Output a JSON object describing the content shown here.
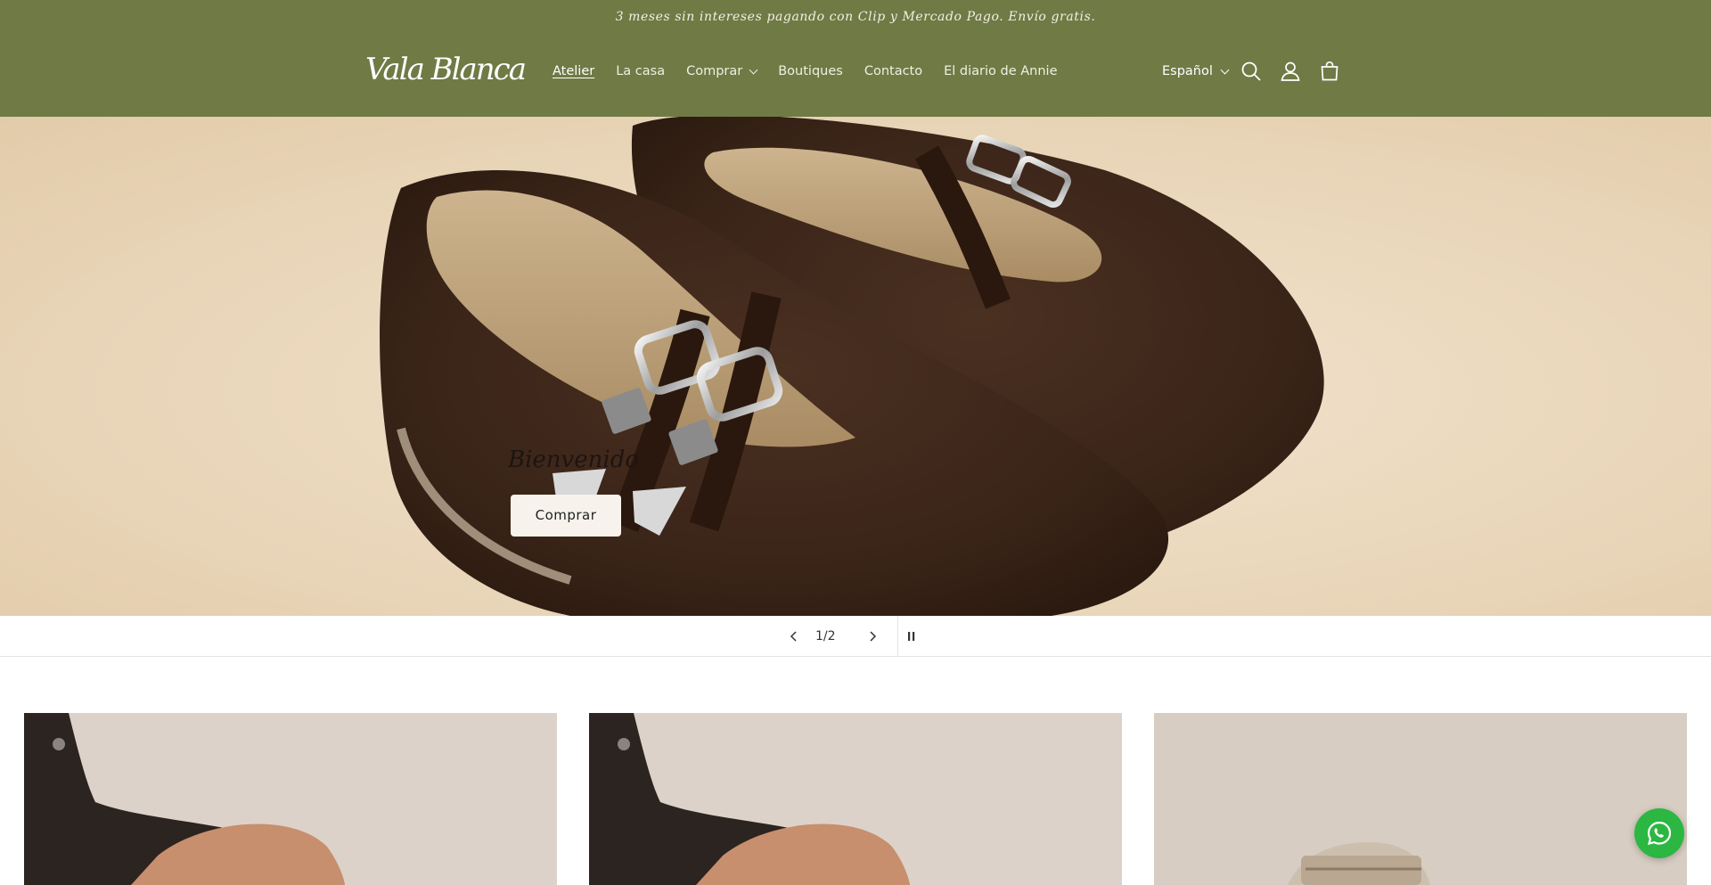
{
  "announcement": "3 meses sin intereses pagando con Clip y Mercado Pago. Envío gratis.",
  "header": {
    "logo": "Vala Blanca",
    "nav": [
      {
        "label": "Atelier",
        "active": true
      },
      {
        "label": "La casa"
      },
      {
        "label": "Comprar",
        "dropdown": true
      },
      {
        "label": "Boutiques"
      },
      {
        "label": "Contacto"
      },
      {
        "label": "El diario de Annie"
      }
    ],
    "language": "Español",
    "icons": [
      "search-icon",
      "account-icon",
      "cart-icon"
    ]
  },
  "hero": {
    "title": "Bienvenido",
    "button": "Comprar"
  },
  "slider": {
    "current": "1",
    "total": "2",
    "separator": "/",
    "icons": [
      "chevron-left-icon",
      "chevron-right-icon",
      "pause-icon"
    ]
  },
  "colors": {
    "header_bg": "#6f7a45",
    "announcement_text": "#f4efe4",
    "whatsapp": "#2bb741"
  },
  "floating": {
    "icon": "whatsapp-icon"
  }
}
